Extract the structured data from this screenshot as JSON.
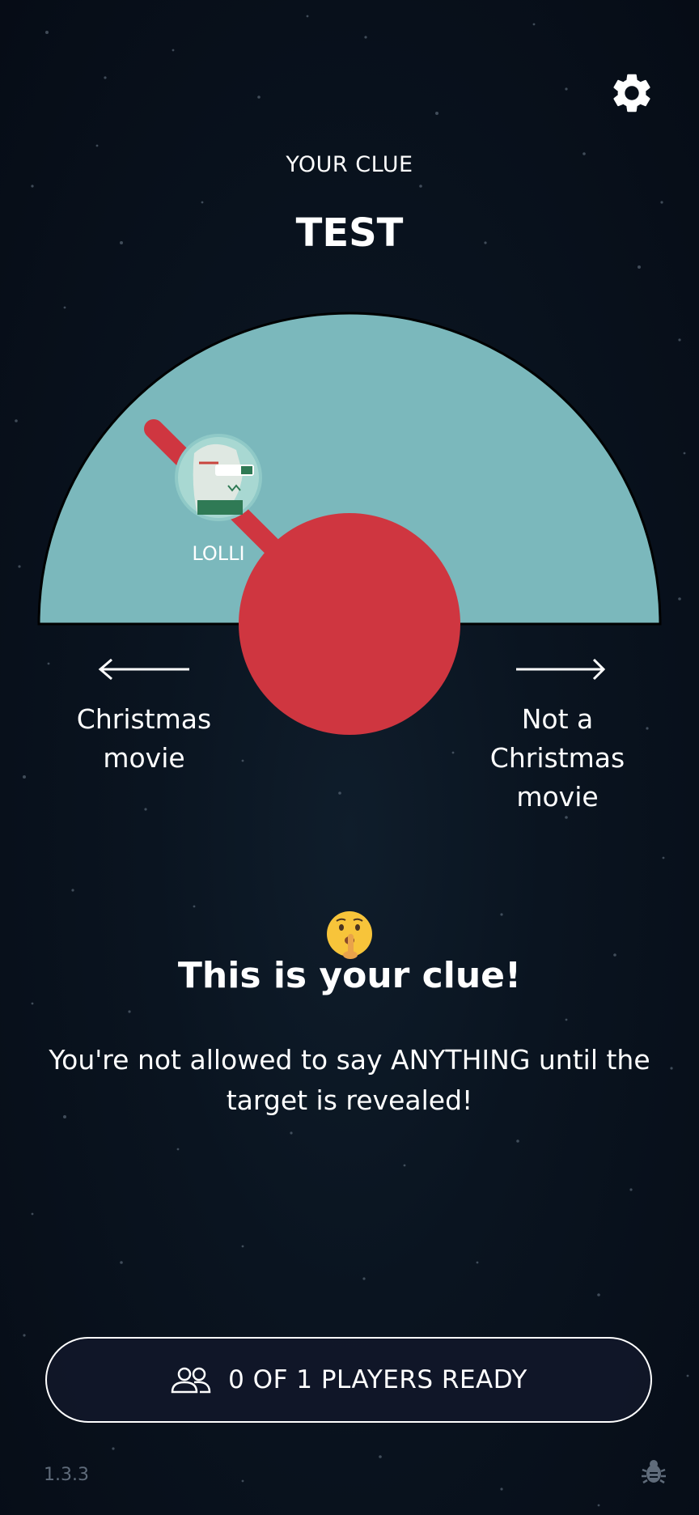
{
  "header": {
    "clue_label": "YOUR CLUE",
    "clue_word": "TEST",
    "settings_icon": "gear-icon"
  },
  "dial": {
    "player_name": "LOLLI",
    "player_avatar_icon": "player-avatar-icon",
    "left_label": "Christmas movie",
    "right_label": "Not a Christmas movie",
    "left_arrow_icon": "arrow-left-icon",
    "right_arrow_icon": "arrow-right-icon",
    "colors": {
      "dial_face": "#7bb8bc",
      "knob": "#cf3640",
      "needle": "#cf3640",
      "outline": "#000000"
    }
  },
  "info": {
    "emoji_icon": "shushing-face-icon",
    "title": "This is your clue!",
    "text": "You're not allowed to say ANYTHING until the target is revealed!"
  },
  "footer": {
    "ready_button_label": "0 OF 1 PLAYERS READY",
    "players_icon": "players-icon",
    "version": "1.3.3",
    "bug_icon": "bug-icon"
  }
}
